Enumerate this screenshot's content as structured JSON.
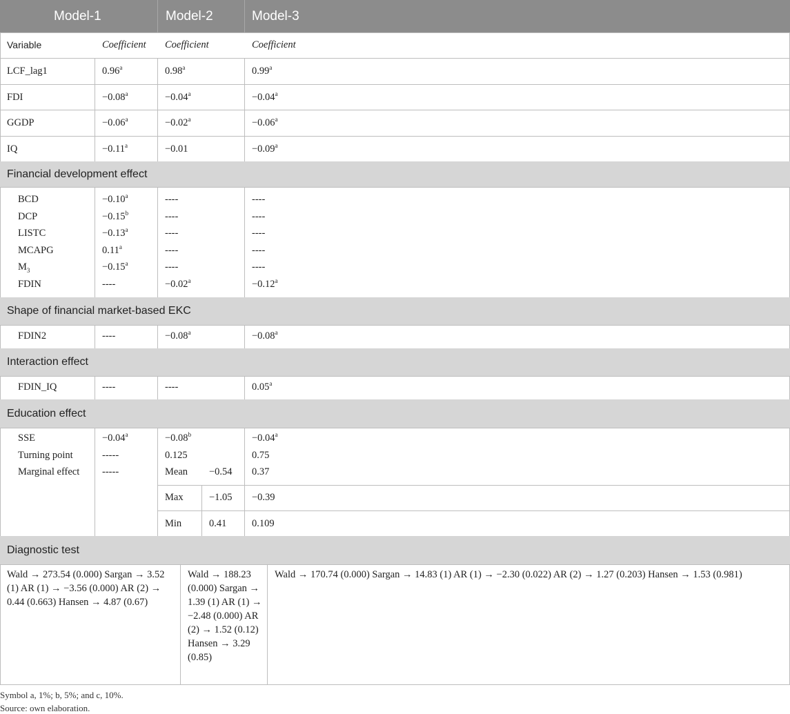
{
  "header": {
    "model1": "Model-1",
    "model2": "Model-2",
    "model3": "Model-3"
  },
  "subheader": {
    "variable": "Variable",
    "coef1": "Coefficient",
    "coef2": "Coefficient",
    "coef3": "Coefficient"
  },
  "rows_main": [
    {
      "var": "LCF_lag1",
      "m1": "0.96",
      "m1s": "a",
      "m2": "0.98",
      "m2s": "a",
      "m3": "0.99",
      "m3s": "a"
    },
    {
      "var": "FDI",
      "m1": "−0.08",
      "m1s": "a",
      "m2": "−0.04",
      "m2s": "a",
      "m3": "−0.04",
      "m3s": "a"
    },
    {
      "var": "GGDP",
      "m1": "−0.06",
      "m1s": "a",
      "m2": "−0.02",
      "m2s": "a",
      "m3": "−0.06",
      "m3s": "a"
    },
    {
      "var": "IQ",
      "m1": "−0.11",
      "m1s": "a",
      "m2": "−0.01",
      "m2s": "",
      "m3": "−0.09",
      "m3s": "a"
    }
  ],
  "sections": {
    "fin_dev": "Financial development effect",
    "shape": "Shape of financial market-based EKC",
    "interaction": "Interaction effect",
    "education": "Education effect",
    "diagnostic": "Diagnostic test"
  },
  "rows_fin": [
    {
      "var": "BCD",
      "m1": "−0.10",
      "m1s": "a",
      "m2": "----",
      "m2s": "",
      "m3": "----",
      "m3s": ""
    },
    {
      "var": "DCP",
      "m1": "−0.15",
      "m1s": "b",
      "m2": "----",
      "m2s": "",
      "m3": "----",
      "m3s": ""
    },
    {
      "var": "LISTC",
      "m1": "−0.13",
      "m1s": "a",
      "m2": "----",
      "m2s": "",
      "m3": "----",
      "m3s": ""
    },
    {
      "var": "MCAPG",
      "m1": "0.11",
      "m1s": "a",
      "m2": "----",
      "m2s": "",
      "m3": "----",
      "m3s": ""
    },
    {
      "var": "M",
      "varsub": "3",
      "m1": "−0.15",
      "m1s": "a",
      "m2": "----",
      "m2s": "",
      "m3": "----",
      "m3s": ""
    },
    {
      "var": "FDIN",
      "m1": "----",
      "m1s": "",
      "m2": "−0.02",
      "m2s": "a",
      "m3": "−0.12",
      "m3s": "a"
    }
  ],
  "row_shape": {
    "var": "FDIN2",
    "m1": "----",
    "m2": "−0.08",
    "m2s": "a",
    "m3": "−0.08",
    "m3s": "a"
  },
  "row_interaction": {
    "var": "FDIN_IQ",
    "m1": "----",
    "m2": "----",
    "m3": "0.05",
    "m3s": "a"
  },
  "education": {
    "sse": {
      "var": "SSE",
      "m1": "−0.04",
      "m1s": "a",
      "m2": "−0.08",
      "m2s": "b",
      "m3": "−0.04",
      "m3s": "a"
    },
    "turning": {
      "var": "Turning point",
      "m1": "-----",
      "m2": "0.125",
      "m3": "0.75"
    },
    "marginal": {
      "var": "Marginal effect",
      "m1": "-----"
    },
    "mean": {
      "label": "Mean",
      "m2": "−0.54",
      "m3": "0.37"
    },
    "max": {
      "label": "Max",
      "m2": "−1.05",
      "m3": "−0.39"
    },
    "min": {
      "label": "Min",
      "m2": "0.41",
      "m3": "0.109"
    }
  },
  "diagnostic": {
    "m1": "Wald → 273.54 (0.000) Sargan → 3.52 (1) AR (1) → −3.56 (0.000) AR (2) → 0.44 (0.663) Hansen → 4.87 (0.67)",
    "m2": "Wald → 188.23 (0.000) Sargan → 1.39 (1) AR (1) → −2.48 (0.000) AR (2) → 1.52 (0.12) Hansen → 3.29 (0.85)",
    "m3": "Wald → 170.74 (0.000) Sargan → 14.83 (1) AR (1) → −2.30 (0.022) AR (2) → 1.27 (0.203) Hansen → 1.53 (0.981)"
  },
  "notes": {
    "symbol": "Symbol a, 1%; b, 5%; and c, 10%.",
    "source": "Source: own elaboration."
  }
}
